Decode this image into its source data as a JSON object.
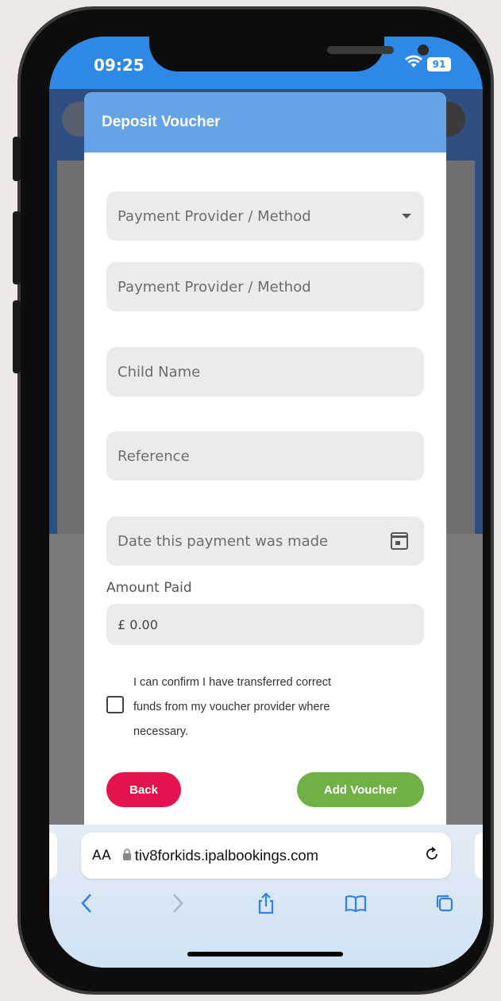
{
  "status": {
    "time": "09:25",
    "battery": "91",
    "wifi_icon": "wifi-icon"
  },
  "modal": {
    "title": "Deposit Voucher",
    "fields": {
      "provider_select_placeholder": "Payment Provider / Method",
      "provider_input_placeholder": "Payment Provider / Method",
      "child_name_placeholder": "Child Name",
      "reference_placeholder": "Reference",
      "date_placeholder": "Date this payment was made"
    },
    "amount": {
      "label": "Amount Paid",
      "value": "£ 0.00"
    },
    "confirm": {
      "lines": [
        "I can confirm I have transferred correct",
        "funds from my voucher provider where",
        "necessary."
      ],
      "checked": false
    },
    "buttons": {
      "back": "Back",
      "add": "Add Voucher"
    },
    "colors": {
      "header": "#64a3e5",
      "back": "#e3144c",
      "add": "#6fb144"
    }
  },
  "browser": {
    "text_size": "AA",
    "url": "tiv8forkids.ipalbookings.com",
    "icons": [
      "back-icon",
      "forward-icon",
      "share-icon",
      "bookmarks-icon",
      "tabs-icon"
    ]
  }
}
